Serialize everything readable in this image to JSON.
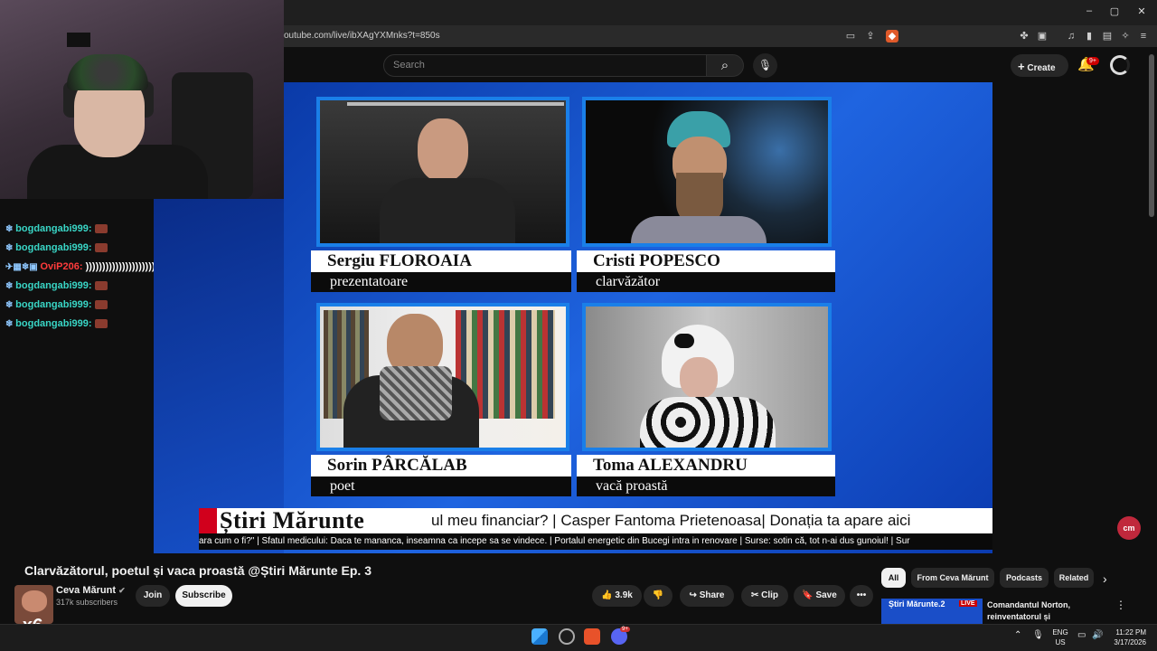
{
  "browser": {
    "url": "outube.com/live/ibXAgYXMnks?t=850s",
    "window_controls": {
      "minimize": "–",
      "maximize": "▢",
      "close": "✕"
    }
  },
  "youtube": {
    "search_placeholder": "Search",
    "create_label": "Create",
    "notifications_badge": "9+"
  },
  "chat": [
    {
      "name": "bogdangabi999:",
      "color": "#39d6c6"
    },
    {
      "name": "bogdangabi999:",
      "color": "#39d6c6"
    },
    {
      "name": "OviP206:",
      "color": "#ff3b3b",
      "message": "))))))))))))))))))))))))))"
    },
    {
      "name": "bogdangabi999:",
      "color": "#39d6c6"
    },
    {
      "name": "bogdangabi999:",
      "color": "#39d6c6"
    },
    {
      "name": "bogdangabi999:",
      "color": "#39d6c6"
    }
  ],
  "broadcast": {
    "panels": [
      {
        "name": "Sergiu FLOROAIA",
        "role": "prezentatoare"
      },
      {
        "name": "Cristi POPESCO",
        "role": "clarvăzător"
      },
      {
        "name": "Sorin PÂRCĂLAB",
        "role": "poet"
      },
      {
        "name": "Toma ALEXANDRU",
        "role": "vacă proastă"
      }
    ],
    "ticker_brand": "Știri Mărunte",
    "ticker_main": "ul meu financiar?  |  Casper Fantoma Prietenoasa|  Donația ta apare aici",
    "ticker_sub": "ara cum o fi?\"  | Sfatul medicului: Daca te mananca, inseamna ca incepe sa se vindece.  |  Portalul energetic din Bucegi intra in renovare  |  Surse: sotin că, tot n-ai dus gunoiul! | Sur",
    "cm_badge": "cm"
  },
  "video": {
    "title": "Clarvăzătorul, poetul și vaca proastă @Știri Mărunte Ep. 3",
    "channel": "Ceva Mărunt",
    "subscribers": "317k subscribers",
    "join": "Join",
    "subscribe": "Subscribe",
    "likes": "3.9k",
    "share": "Share",
    "clip": "Clip",
    "save": "Save",
    "more": "•••",
    "overlay_multiplier": "x6"
  },
  "sidebar": {
    "chips": [
      "All",
      "From Ceva Mărunt",
      "Podcasts",
      "Related"
    ],
    "rec_title": "Comandantul Norton, reinventatorul și dezdecorator...",
    "rec_thumb_text": "Știri Mărunte.2",
    "rec_live": "LIVE"
  },
  "taskbar": {
    "lang": [
      "ENG",
      "US"
    ],
    "time": "11:22 PM",
    "date": "3/17/2026",
    "discord_badge": "9+"
  }
}
